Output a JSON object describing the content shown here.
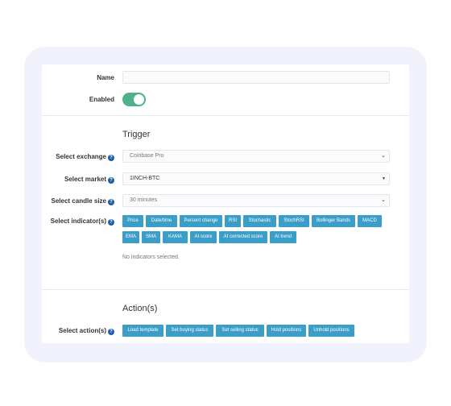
{
  "form": {
    "name": {
      "label": "Name",
      "value": ""
    },
    "enabled": {
      "label": "Enabled",
      "on": true
    }
  },
  "trigger": {
    "title": "Trigger",
    "exchange": {
      "label": "Select exchange",
      "value": "Coinbase Pro"
    },
    "market": {
      "label": "Select market",
      "value": "1INCH-BTC"
    },
    "candle": {
      "label": "Select candle size",
      "value": "30 minutes"
    },
    "indicators": {
      "label": "Select indicator(s)",
      "buttons": [
        "Price",
        "Date/time",
        "Percent change",
        "RSI",
        "Stochastic",
        "StochRSI",
        "Bollinger Bands",
        "MACD",
        "EMA",
        "SMA",
        "KAMA",
        "AI score",
        "AI corrected score",
        "AI trend"
      ],
      "empty_text": "No indicators selected."
    }
  },
  "actions": {
    "title": "Action(s)",
    "label": "Select action(s)",
    "buttons": [
      "Load template",
      "Set buying status",
      "Set selling status",
      "Hold positions",
      "Unhold positions"
    ]
  },
  "icons": {
    "help": "question-circle-icon",
    "select": "chevron-down-icon"
  },
  "colors": {
    "accent": "#3a9ec8",
    "toggle": "#4eb28a",
    "help": "#1e5fa8"
  }
}
